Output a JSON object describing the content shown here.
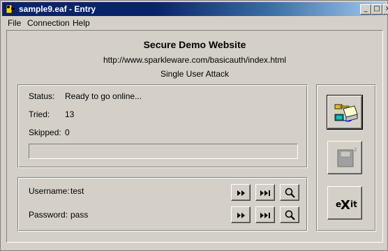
{
  "window": {
    "title": "sample9.eaf - Entry"
  },
  "titlebar_buttons": {
    "minimize": "_",
    "maximize": "□",
    "close": "×"
  },
  "menu": [
    "File",
    "Connection",
    "Help"
  ],
  "site": {
    "title": "Secure Demo Website",
    "url": "http://www.sparkleware.com/basicauth/index.html",
    "attack_mode": "Single User Attack"
  },
  "status": {
    "status_label": "Status:",
    "status_value": "Ready to go online...",
    "tried_label": "Tried:",
    "tried_value": "13",
    "skipped_label": "Skipped:",
    "skipped_value": "0",
    "progress": 0
  },
  "credentials": {
    "username_label": "Username:",
    "username_value": "test",
    "password_label": "Password:",
    "password_value": "pass"
  },
  "icons": {
    "play": "fast-forward-icon",
    "skip": "skip-to-end-icon",
    "search": "magnifier-icon",
    "start": "keys-computer-icon",
    "disk": "disk-icon",
    "exit": "exit-icon"
  },
  "exit_button": {
    "label": "eXit"
  }
}
